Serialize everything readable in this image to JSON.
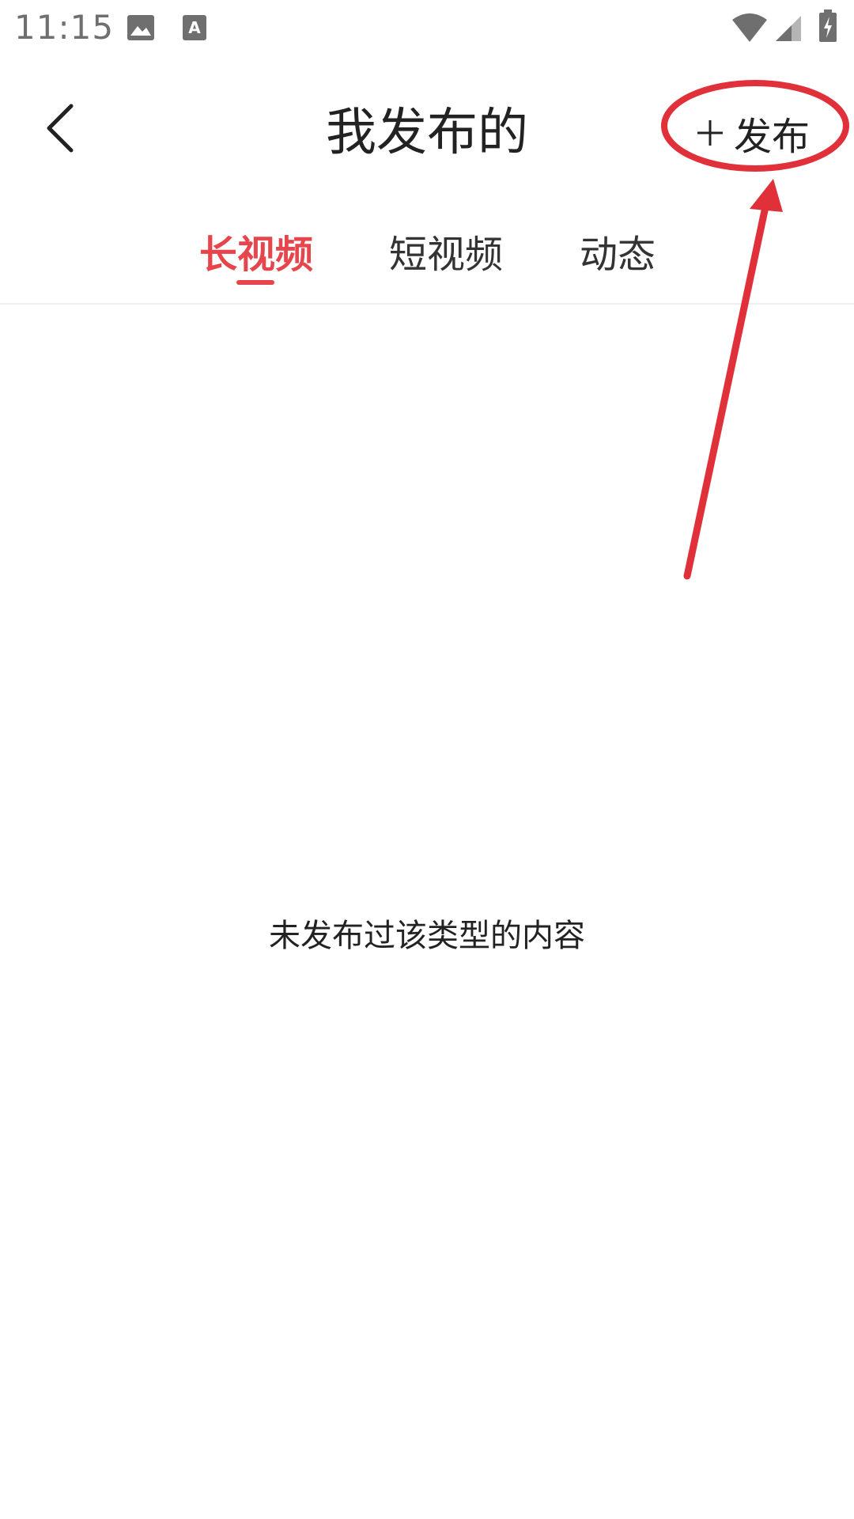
{
  "status_bar": {
    "time": "11:15",
    "icons": [
      "gallery-icon",
      "a-box-icon",
      "wifi-icon",
      "signal-icon",
      "battery-icon"
    ]
  },
  "header": {
    "title": "我发布的",
    "back_icon": "chevron-left-icon",
    "publish": {
      "icon": "plus-icon",
      "label": "发布"
    }
  },
  "tabs": [
    {
      "label": "长视频",
      "active": true
    },
    {
      "label": "短视频",
      "active": false
    },
    {
      "label": "动态",
      "active": false
    }
  ],
  "main": {
    "empty_message": "未发布过该类型的内容"
  },
  "colors": {
    "accent": "#e6464b",
    "annotation": "#e0313a",
    "text": "#222222",
    "status_gray": "#6f6f6f"
  }
}
